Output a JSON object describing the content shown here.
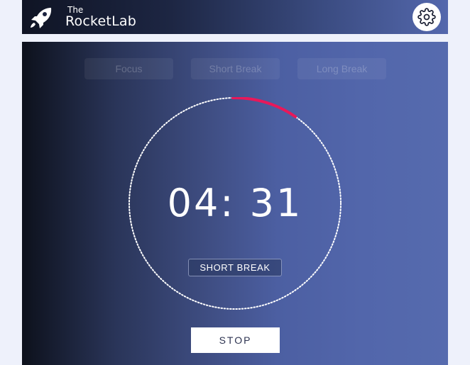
{
  "header": {
    "brand_small": "The",
    "brand_big": "RocketLab",
    "logo_icon": "rocket-icon",
    "settings_icon": "gear-icon"
  },
  "tabs": [
    {
      "label": "Focus"
    },
    {
      "label": "Short Break"
    },
    {
      "label": "Long Break"
    }
  ],
  "timer": {
    "display": "04: 31",
    "mode_label": "SHORT BREAK",
    "progress_fraction": 0.1
  },
  "controls": {
    "stop_label": "STOP"
  },
  "colors": {
    "progress_arc": "#e8185a",
    "ring_dots": "#ffffff"
  }
}
